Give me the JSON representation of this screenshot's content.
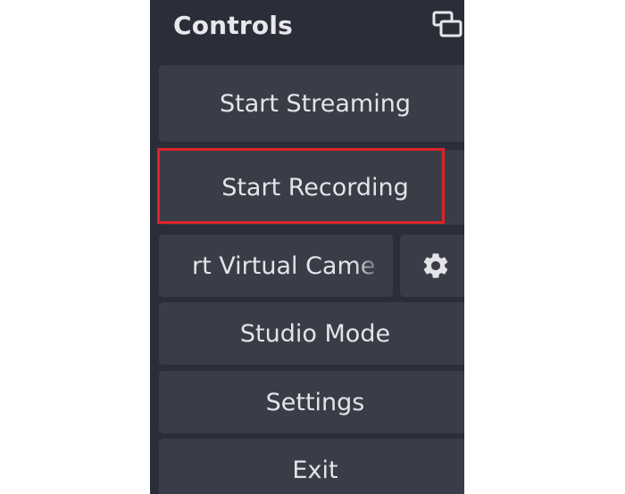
{
  "panel": {
    "title": "Controls",
    "icons": {
      "undock": "undock-icon",
      "gear": "gear-icon"
    }
  },
  "buttons": {
    "start_streaming": "Start Streaming",
    "start_recording": "Start Recording",
    "start_virtual_camera": "rt Virtual Camе",
    "studio_mode": "Studio Mode",
    "settings": "Settings",
    "exit": "Exit"
  },
  "colors": {
    "panel_bg": "#2b2e38",
    "button_bg": "#3a3d48",
    "text": "#e4e4e8",
    "highlight": "#e0222a"
  }
}
